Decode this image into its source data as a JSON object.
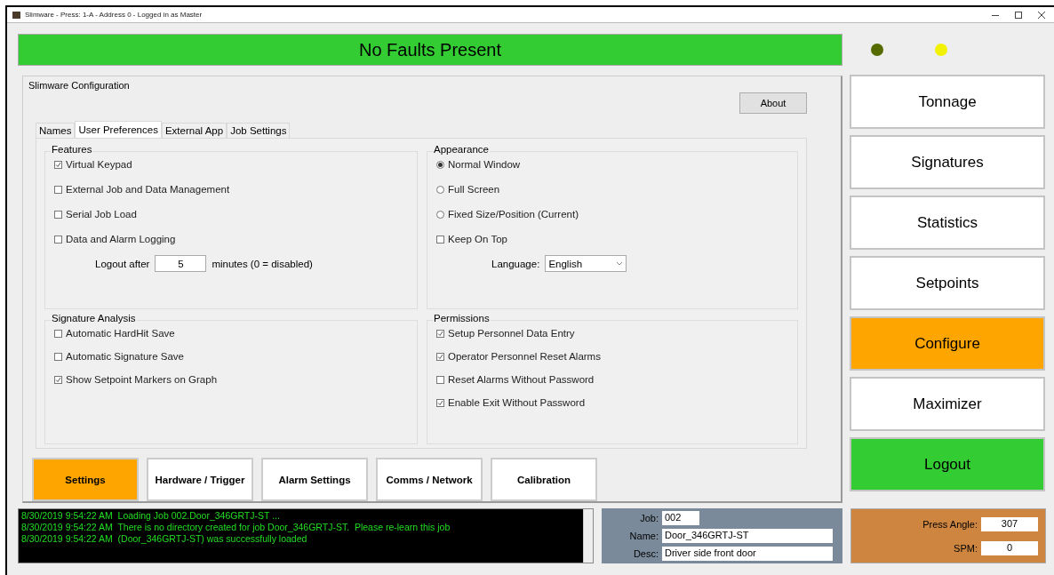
{
  "window": {
    "title": "Slimware - Press: 1-A - Address 0 - Logged in as Master"
  },
  "fault_banner": {
    "text": "No Faults Present"
  },
  "indicators": [
    {
      "color": "#556b00"
    },
    {
      "color": "#f2f200"
    }
  ],
  "config": {
    "title": "Slimware Configuration",
    "about_button": "About",
    "tabs": [
      {
        "label": "Names",
        "selected": false
      },
      {
        "label": "User Preferences",
        "selected": true
      },
      {
        "label": "External App",
        "selected": false
      },
      {
        "label": "Job Settings",
        "selected": false
      }
    ],
    "groups": [
      {
        "title": "Features",
        "items": [
          {
            "kind": "checkbox",
            "label": "Virtual Keypad",
            "checked": true
          },
          {
            "kind": "checkbox",
            "label": "External Job and Data Management",
            "checked": false
          },
          {
            "kind": "checkbox",
            "label": "Serial Job Load",
            "checked": false
          },
          {
            "kind": "checkbox",
            "label": "Data and Alarm Logging",
            "checked": false
          }
        ],
        "field": {
          "kind": "text",
          "label": "Logout after",
          "value": "5",
          "suffix": "minutes (0 = disabled)"
        }
      },
      {
        "title": "Appearance",
        "items": [
          {
            "kind": "radio",
            "label": "Normal Window",
            "selected": true
          },
          {
            "kind": "radio",
            "label": "Full Screen",
            "selected": false
          },
          {
            "kind": "radio",
            "label": "Fixed Size/Position (Current)",
            "selected": false
          },
          {
            "kind": "checkbox",
            "label": "Keep On Top",
            "checked": false
          }
        ],
        "field": {
          "kind": "select",
          "label": "Language:",
          "value": "English"
        }
      },
      {
        "title": "Signature Analysis",
        "items": [
          {
            "kind": "checkbox",
            "label": "Automatic HardHit Save",
            "checked": false
          },
          {
            "kind": "checkbox",
            "label": "Automatic Signature Save",
            "checked": false
          },
          {
            "kind": "checkbox",
            "label": "Show Setpoint Markers on Graph",
            "checked": true
          }
        ]
      },
      {
        "title": "Permissions",
        "items": [
          {
            "kind": "checkbox",
            "label": "Setup Personnel Data Entry",
            "checked": true
          },
          {
            "kind": "checkbox",
            "label": "Operator Personnel Reset Alarms",
            "checked": true
          },
          {
            "kind": "checkbox",
            "label": "Reset Alarms Without Password",
            "checked": false
          },
          {
            "kind": "checkbox",
            "label": "Enable Exit Without Password",
            "checked": true
          }
        ]
      }
    ],
    "section_buttons": [
      {
        "label": "Settings",
        "selected": true
      },
      {
        "label": "Hardware / Trigger",
        "selected": false
      },
      {
        "label": "Alarm Settings",
        "selected": false
      },
      {
        "label": "Comms / Network",
        "selected": false
      },
      {
        "label": "Calibration",
        "selected": false
      }
    ]
  },
  "nav": [
    {
      "label": "Tonnage",
      "kind": "nav",
      "selected": false
    },
    {
      "label": "Signatures",
      "kind": "nav",
      "selected": false
    },
    {
      "label": "Statistics",
      "kind": "nav",
      "selected": false
    },
    {
      "label": "Setpoints",
      "kind": "nav",
      "selected": false
    },
    {
      "label": "Configure",
      "kind": "nav",
      "selected": true
    },
    {
      "label": "Maximizer",
      "kind": "nav",
      "selected": false
    },
    {
      "label": "Logout",
      "kind": "action",
      "selected": false
    }
  ],
  "log": [
    "8/30/2019 9:54:22 AM  Loading Job 002.Door_346GRTJ-ST ...",
    "8/30/2019 9:54:22 AM  There is no directory created for job Door_346GRTJ-ST.  Please re-learn this job",
    "8/30/2019 9:54:22 AM  (Door_346GRTJ-ST) was successfully loaded"
  ],
  "job": [
    {
      "label": "Job:",
      "value": "002",
      "kind": "short"
    },
    {
      "label": "Name:",
      "value": "Door_346GRTJ-ST",
      "kind": "long"
    },
    {
      "label": "Desc:",
      "value": "Driver side front door",
      "kind": "long"
    }
  ],
  "press": [
    {
      "label": "Press Angle:",
      "value": "307"
    },
    {
      "label": "SPM:",
      "value": "0"
    }
  ]
}
